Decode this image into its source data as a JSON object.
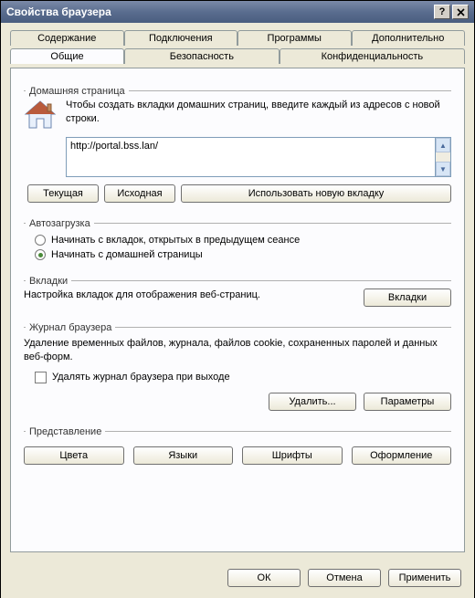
{
  "titlebar": {
    "title": "Свойства браузера"
  },
  "tabs": {
    "row_back": [
      "Содержание",
      "Подключения",
      "Программы",
      "Дополнительно"
    ],
    "row_front": [
      "Общие",
      "Безопасность",
      "Конфиденциальность"
    ]
  },
  "homepage": {
    "group": "Домашняя страница",
    "desc": "Чтобы создать вкладки домашних страниц, введите каждый из адресов с новой строки.",
    "url": "http://portal.bss.lan/",
    "btn_current": "Текущая",
    "btn_default": "Исходная",
    "btn_newtab": "Использовать новую вкладку"
  },
  "startup": {
    "group": "Автозагрузка",
    "opt_tabs": "Начинать с вкладок, открытых в предыдущем сеансе",
    "opt_home": "Начинать с домашней страницы"
  },
  "tabs_group": {
    "group": "Вкладки",
    "desc": "Настройка вкладок для отображения веб-страниц.",
    "btn": "Вкладки"
  },
  "history": {
    "group": "Журнал браузера",
    "desc": "Удаление временных файлов, журнала, файлов cookie, сохраненных паролей и данных веб-форм.",
    "check": "Удалять журнал браузера при выходе",
    "btn_delete": "Удалить...",
    "btn_settings": "Параметры"
  },
  "presentation": {
    "group": "Представление",
    "btn_colors": "Цвета",
    "btn_langs": "Языки",
    "btn_fonts": "Шрифты",
    "btn_access": "Оформление"
  },
  "footer": {
    "ok": "ОК",
    "cancel": "Отмена",
    "apply": "Применить"
  }
}
